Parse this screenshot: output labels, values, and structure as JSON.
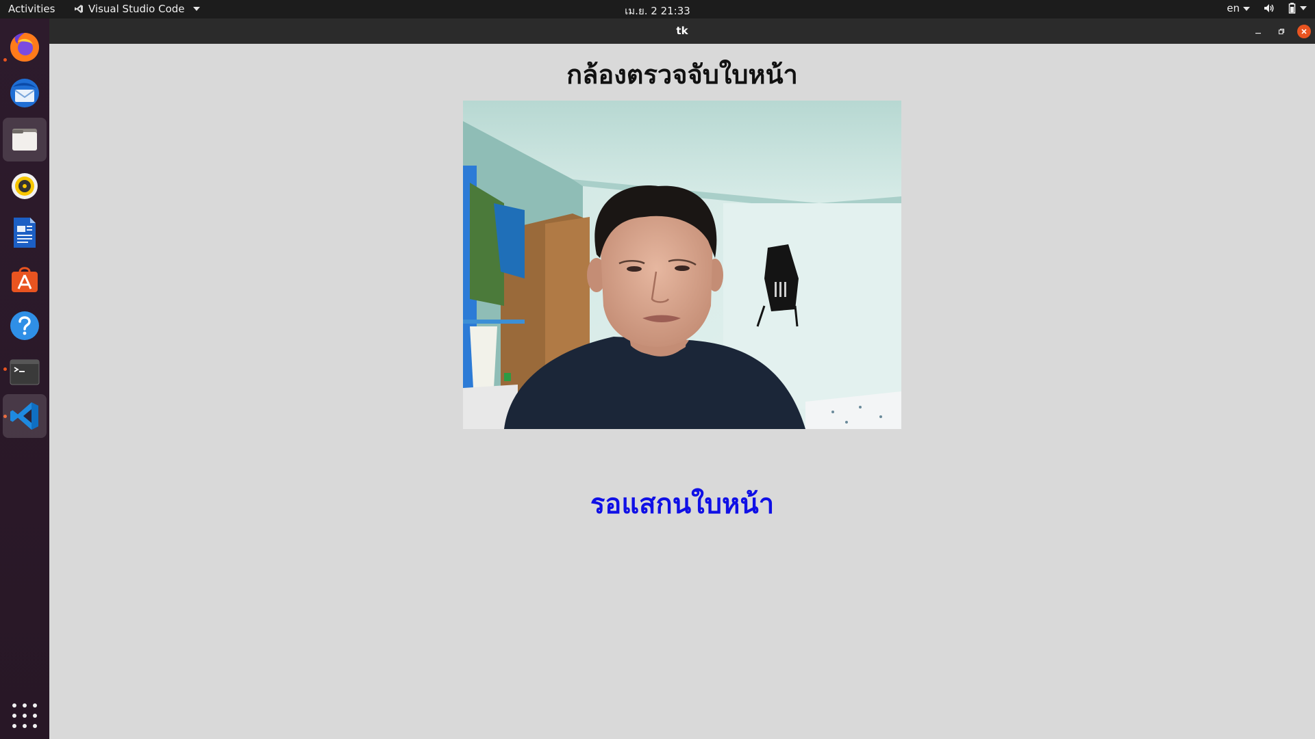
{
  "topbar": {
    "activities": "Activities",
    "app_menu": "Visual Studio Code",
    "clock": "เม.ย. 2  21:33",
    "language": "en"
  },
  "dock": {
    "items": [
      {
        "name": "firefox",
        "running": true
      },
      {
        "name": "thunderbird",
        "running": false
      },
      {
        "name": "files",
        "running": false
      },
      {
        "name": "rhythmbox",
        "running": false
      },
      {
        "name": "libreoffice-writer",
        "running": false
      },
      {
        "name": "ubuntu-software",
        "running": false
      },
      {
        "name": "help",
        "running": false
      },
      {
        "name": "terminal",
        "running": true
      },
      {
        "name": "vscode",
        "running": true
      }
    ]
  },
  "window": {
    "title": "tk",
    "heading": "กล้องตรวจจับใบหน้า",
    "status": "รอแสกนใบหน้า",
    "status_color": "#1010e6"
  },
  "colors": {
    "accent": "#e95420",
    "window_bg": "#d9d9d9"
  }
}
